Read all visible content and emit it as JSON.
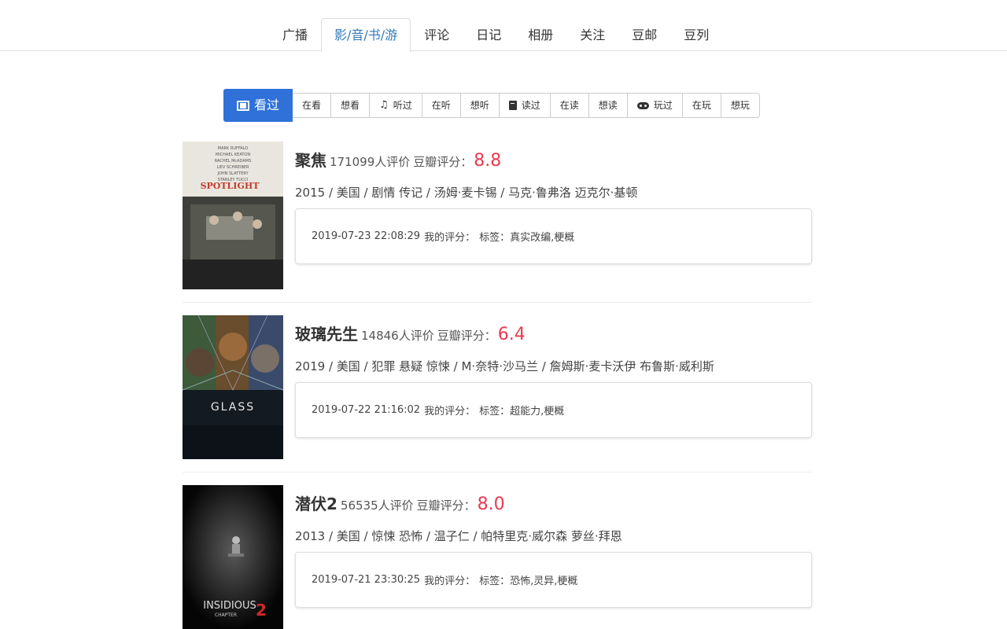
{
  "nav": {
    "items": [
      "广播",
      "影/音/书/游",
      "评论",
      "日记",
      "相册",
      "关注",
      "豆邮",
      "豆列"
    ],
    "active_index": 1
  },
  "subtabs": {
    "watched": "看过",
    "watching": "在看",
    "want_watch": "想看",
    "listened": "听过",
    "listening": "在听",
    "want_listen": "想听",
    "read": "读过",
    "reading": "在读",
    "want_read": "想读",
    "played": "玩过",
    "playing": "在玩",
    "want_play": "想玩"
  },
  "colors": {
    "accent": "#2f71d9",
    "score": "#e83a50",
    "link": "#337ab7"
  },
  "movies": [
    {
      "title": "聚焦",
      "rating_count": "171099人评价",
      "score_label": "豆瓣评分：",
      "score": "8.8",
      "meta": "2015 / 美国 / 剧情 传记 / 汤姆·麦卡锡 / 马克·鲁弗洛 迈克尔·基顿",
      "date": "2019-07-23 22:08:29",
      "my_rating_label": "我的评分：",
      "tags": "标签：真实改编,梗概",
      "poster_text": "SPOTLIGHT"
    },
    {
      "title": "玻璃先生",
      "rating_count": "14846人评价",
      "score_label": "豆瓣评分：",
      "score": "6.4",
      "meta": "2019 / 美国 / 犯罪 悬疑 惊悚 / M·奈特·沙马兰 / 詹姆斯·麦卡沃伊 布鲁斯·威利斯",
      "date": "2019-07-22 21:16:02",
      "my_rating_label": "我的评分：",
      "tags": "标签：超能力,梗概",
      "poster_text": "GLASS"
    },
    {
      "title": "潜伏2",
      "rating_count": "56535人评价",
      "score_label": "豆瓣评分：",
      "score": "8.0",
      "meta": "2013 / 美国 / 惊悚 恐怖 / 温子仁 / 帕特里克·威尔森 萝丝·拜恩",
      "date": "2019-07-21 23:30:25",
      "my_rating_label": "我的评分：",
      "tags": "标签：恐怖,灵异,梗概",
      "poster_text": "INSIDIOUS",
      "poster_subtext": "CHAPTER",
      "poster_number": "2"
    }
  ]
}
